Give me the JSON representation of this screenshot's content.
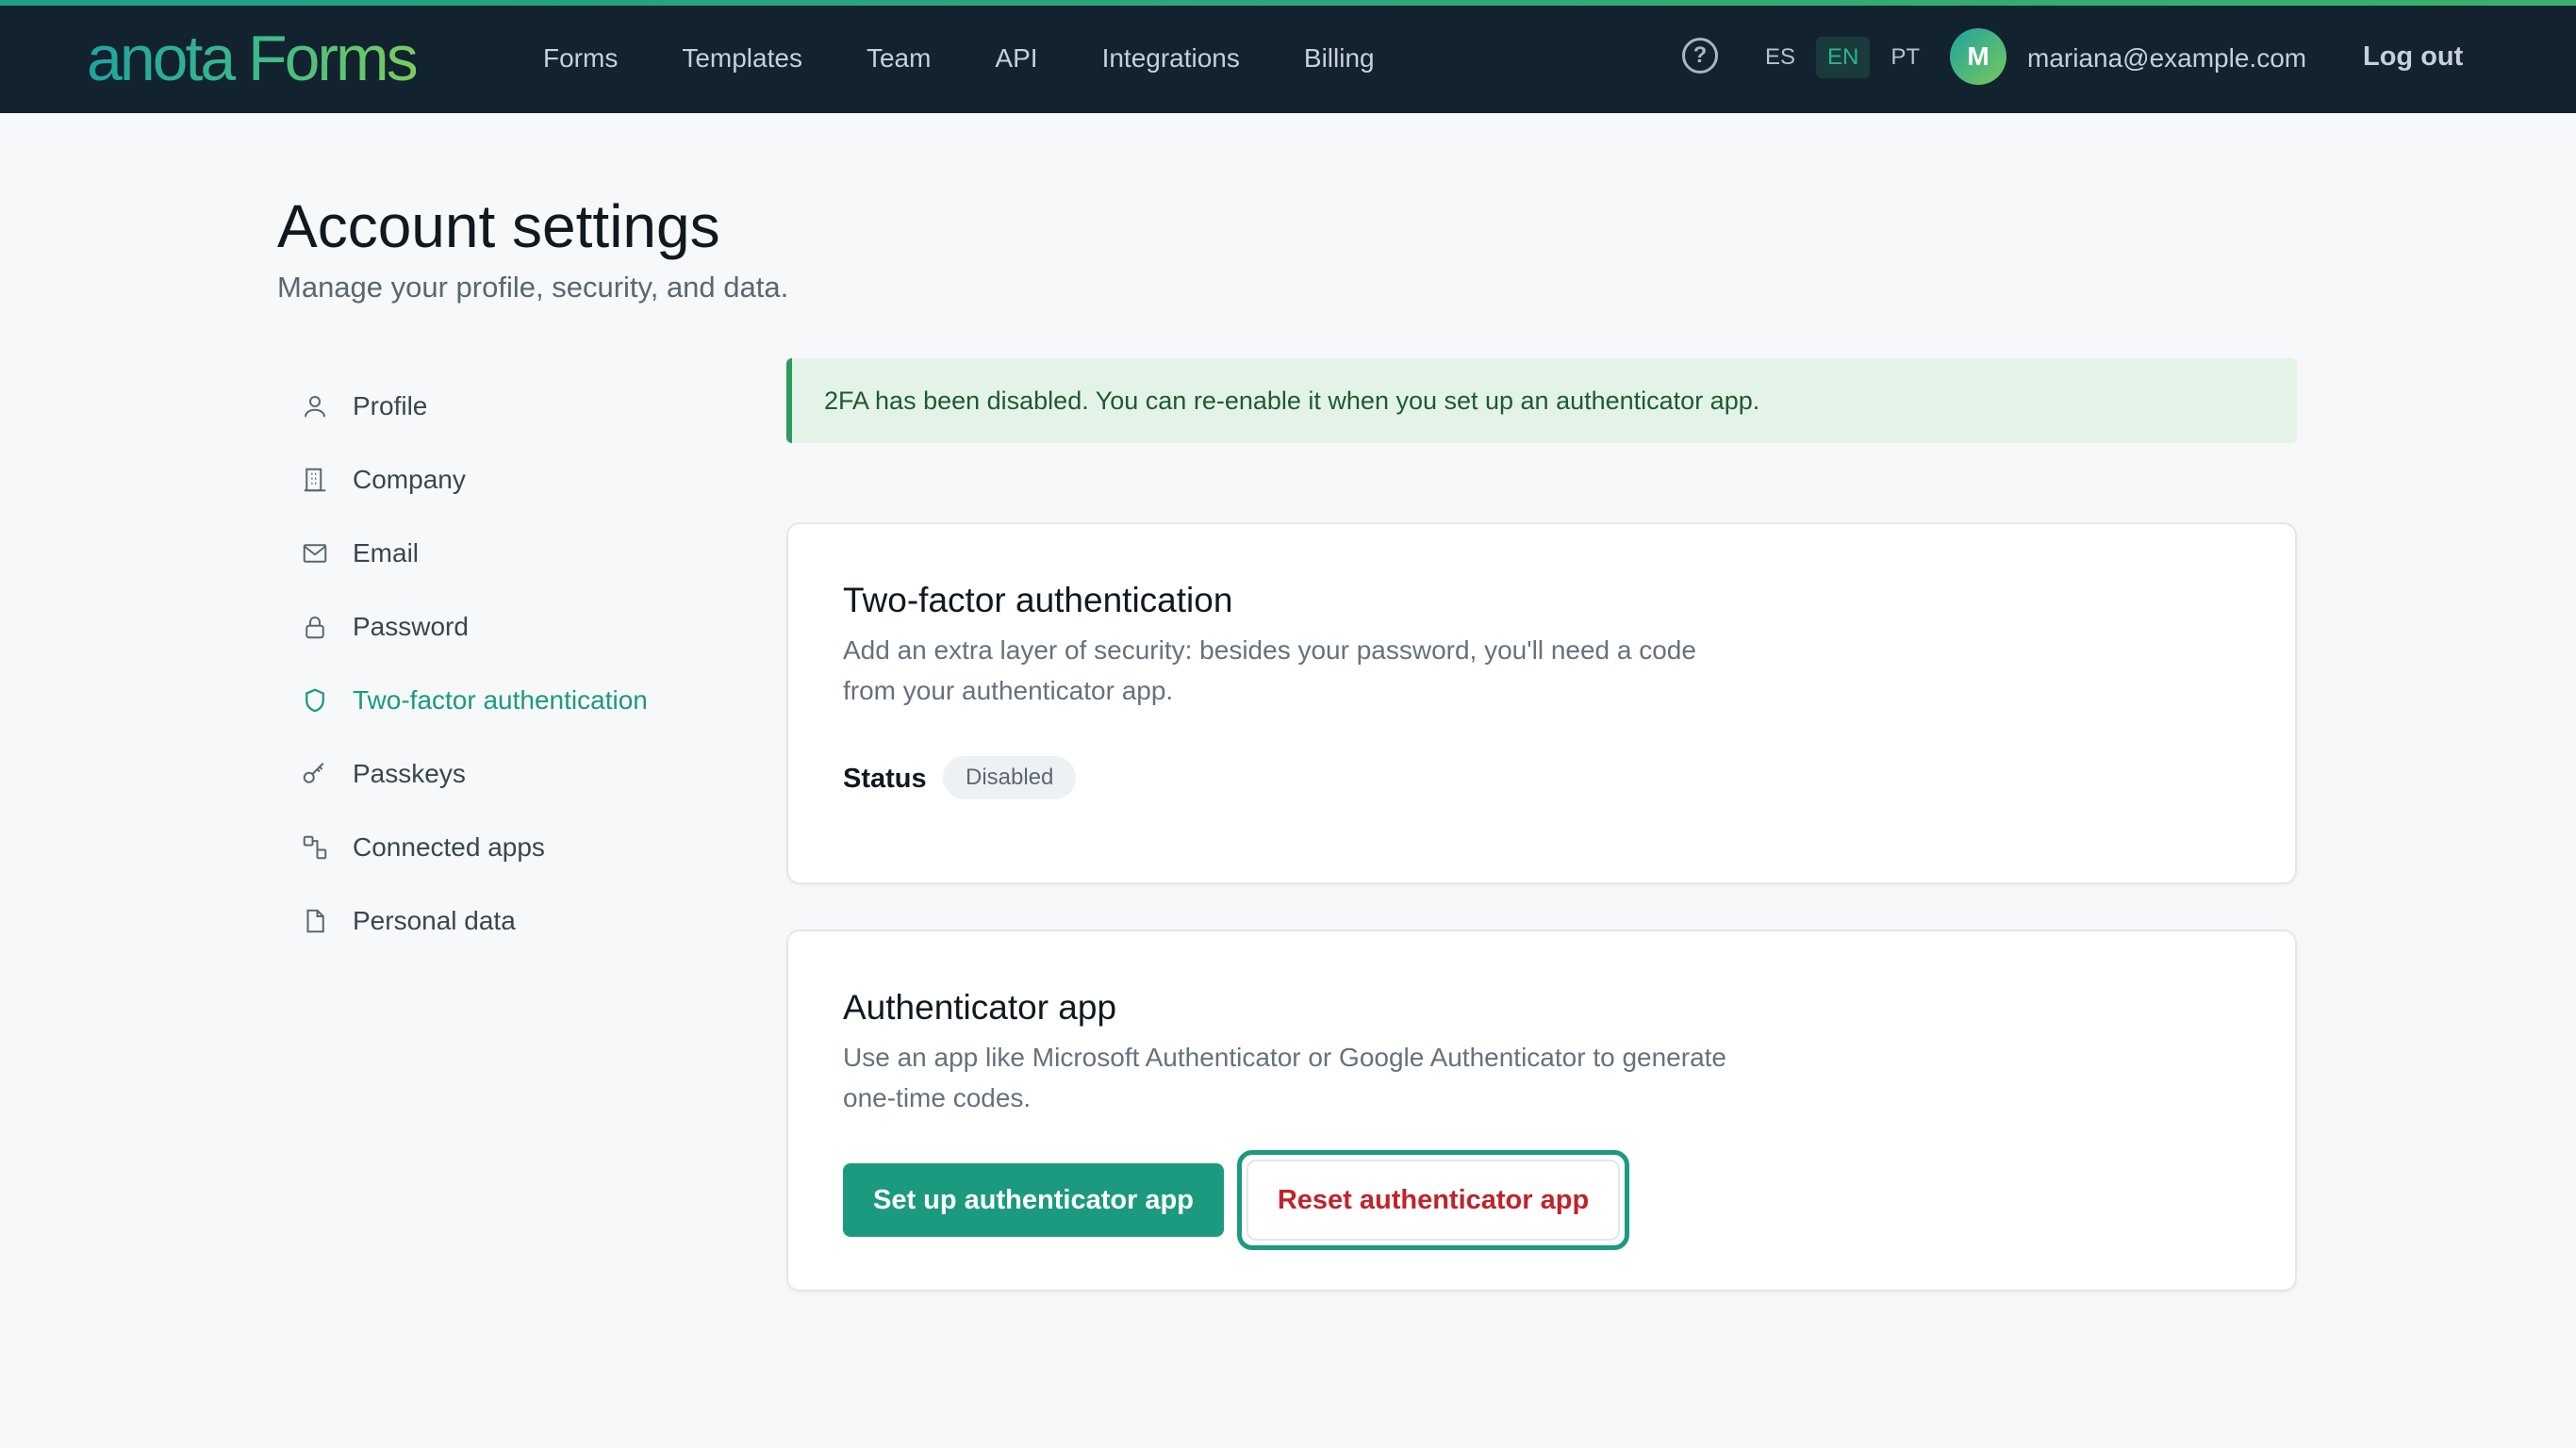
{
  "header": {
    "logo": "anota Forms",
    "nav": [
      "Forms",
      "Templates",
      "Team",
      "API",
      "Integrations",
      "Billing"
    ],
    "help_icon": "?",
    "languages": [
      {
        "code": "ES",
        "active": false
      },
      {
        "code": "EN",
        "active": true
      },
      {
        "code": "PT",
        "active": false
      }
    ],
    "avatar_initial": "M",
    "user_email": "mariana@example.com",
    "logout_label": "Log out"
  },
  "page": {
    "title": "Account settings",
    "subtitle": "Manage your profile, security, and data."
  },
  "sidebar": {
    "items": [
      {
        "label": "Profile",
        "icon": "user-icon",
        "active": false
      },
      {
        "label": "Company",
        "icon": "building-icon",
        "active": false
      },
      {
        "label": "Email",
        "icon": "mail-icon",
        "active": false
      },
      {
        "label": "Password",
        "icon": "lock-icon",
        "active": false
      },
      {
        "label": "Two-factor authentication",
        "icon": "shield-icon",
        "active": true
      },
      {
        "label": "Passkeys",
        "icon": "key-icon",
        "active": false
      },
      {
        "label": "Connected apps",
        "icon": "connected-apps-icon",
        "active": false
      },
      {
        "label": "Personal data",
        "icon": "document-icon",
        "active": false
      }
    ]
  },
  "alert": {
    "message": "2FA has been disabled. You can re-enable it when you set up an authenticator app."
  },
  "two_factor_card": {
    "title": "Two-factor authentication",
    "description": "Add an extra layer of security: besides your password, you'll need a code from your authenticator app.",
    "status_label": "Status",
    "status_value": "Disabled"
  },
  "authenticator_card": {
    "title": "Authenticator app",
    "description": "Use an app like Microsoft Authenticator or Google Authenticator to generate one-time codes.",
    "setup_button": "Set up authenticator app",
    "reset_button": "Reset authenticator app"
  },
  "colors": {
    "topbar": "#12222f",
    "accent": "#1b9a7f",
    "danger": "#c0232b",
    "alert_bg": "#e4f3e8"
  }
}
